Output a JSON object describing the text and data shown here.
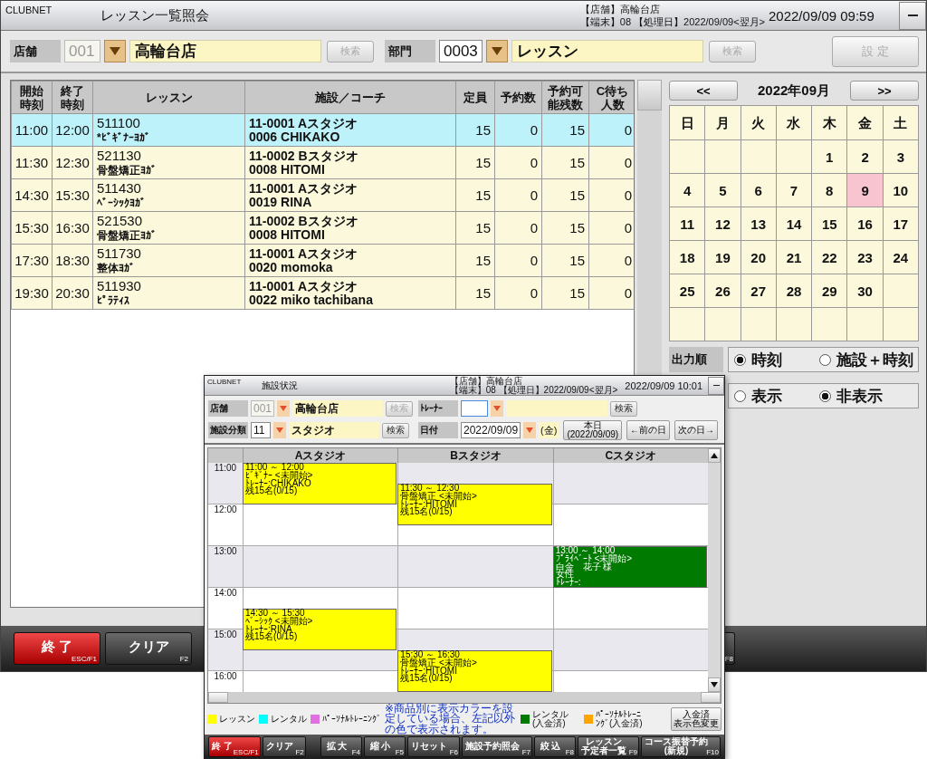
{
  "main": {
    "titlebar": {
      "app": "CLUBNET",
      "title": "レッスン一覧照会",
      "store_info": "【店舗】高輪台店",
      "terminal_info": "【端末】08 【処理日】2022/09/09<翌月>",
      "datetime": "2022/09/09 09:59"
    },
    "filters": [
      {
        "label": "店舗",
        "code": {
          "value": "001",
          "disabled": true
        },
        "name": "高輪台店",
        "search": {
          "label": "検索",
          "disabled": true
        }
      },
      {
        "label": "部門",
        "code": {
          "value": "0003",
          "disabled": false
        },
        "name": "レッスン",
        "search": {
          "label": "検索",
          "disabled": true
        }
      }
    ],
    "settings_button": {
      "label": "設 定",
      "disabled": true
    },
    "table": {
      "columns": [
        "開始時刻",
        "終了時刻",
        "レッスン",
        "施設／コーチ",
        "定員",
        "予約数",
        "予約可能残数",
        "C待ち人数"
      ],
      "rows": [
        {
          "start": "11:00",
          "end": "12:00",
          "lesson_code": "511100",
          "lesson_name": "*ﾋﾞｷﾞﾅｰﾖｶﾞ",
          "facility": "11-0001 Aスタジオ",
          "coach": "0006 CHIKAKO",
          "capacity": "15",
          "reserved": "0",
          "available": "15",
          "waiting": "0",
          "selected": true
        },
        {
          "start": "11:30",
          "end": "12:30",
          "lesson_code": "521130",
          "lesson_name": "骨盤矯正ﾖｶﾞ",
          "facility": "11-0002 Bスタジオ",
          "coach": "0008 HITOMI",
          "capacity": "15",
          "reserved": "0",
          "available": "15",
          "waiting": "0",
          "selected": false
        },
        {
          "start": "14:30",
          "end": "15:30",
          "lesson_code": "511430",
          "lesson_name": "ﾍﾞｰｼｯｸﾖｶﾞ",
          "facility": "11-0001 Aスタジオ",
          "coach": "0019 RINA",
          "capacity": "15",
          "reserved": "0",
          "available": "15",
          "waiting": "0",
          "selected": false
        },
        {
          "start": "15:30",
          "end": "16:30",
          "lesson_code": "521530",
          "lesson_name": "骨盤矯正ﾖｶﾞ",
          "facility": "11-0002 Bスタジオ",
          "coach": "0008 HITOMI",
          "capacity": "15",
          "reserved": "0",
          "available": "15",
          "waiting": "0",
          "selected": false
        },
        {
          "start": "17:30",
          "end": "18:30",
          "lesson_code": "511730",
          "lesson_name": "整体ﾖｶﾞ",
          "facility": "11-0001 Aスタジオ",
          "coach": "0020 momoka",
          "capacity": "15",
          "reserved": "0",
          "available": "15",
          "waiting": "0",
          "selected": false
        },
        {
          "start": "19:30",
          "end": "20:30",
          "lesson_code": "511930",
          "lesson_name": "ﾋﾟﾗﾃｨｽ",
          "facility": "11-0001 Aスタジオ",
          "coach": "0022 miko tachibana",
          "capacity": "15",
          "reserved": "0",
          "available": "15",
          "waiting": "0",
          "selected": false
        }
      ]
    },
    "calendar": {
      "prev": "<<",
      "month": "2022年09月",
      "next": ">>",
      "weekdays": [
        "日",
        "月",
        "火",
        "水",
        "木",
        "金",
        "土"
      ],
      "weeks": [
        [
          {
            "kind": "blank"
          },
          {
            "kind": "blank"
          },
          {
            "kind": "blank"
          },
          {
            "kind": "blank"
          },
          {
            "kind": "day",
            "day": "1",
            "selected": false
          },
          {
            "kind": "day",
            "day": "2",
            "selected": false
          },
          {
            "kind": "day",
            "day": "3",
            "selected": false
          }
        ],
        [
          {
            "kind": "day",
            "day": "4",
            "selected": false
          },
          {
            "kind": "day",
            "day": "5",
            "selected": false
          },
          {
            "kind": "day",
            "day": "6",
            "selected": false
          },
          {
            "kind": "day",
            "day": "7",
            "selected": false
          },
          {
            "kind": "day",
            "day": "8",
            "selected": false
          },
          {
            "kind": "day",
            "day": "9",
            "selected": true
          },
          {
            "kind": "day",
            "day": "10",
            "selected": false
          }
        ],
        [
          {
            "kind": "day",
            "day": "11",
            "selected": false
          },
          {
            "kind": "day",
            "day": "12",
            "selected": false
          },
          {
            "kind": "day",
            "day": "13",
            "selected": false
          },
          {
            "kind": "day",
            "day": "14",
            "selected": false
          },
          {
            "kind": "day",
            "day": "15",
            "selected": false
          },
          {
            "kind": "day",
            "day": "16",
            "selected": false
          },
          {
            "kind": "day",
            "day": "17",
            "selected": false
          }
        ],
        [
          {
            "kind": "day",
            "day": "18",
            "selected": false
          },
          {
            "kind": "day",
            "day": "19",
            "selected": false
          },
          {
            "kind": "day",
            "day": "20",
            "selected": false
          },
          {
            "kind": "day",
            "day": "21",
            "selected": false
          },
          {
            "kind": "day",
            "day": "22",
            "selected": false
          },
          {
            "kind": "day",
            "day": "23",
            "selected": false
          },
          {
            "kind": "day",
            "day": "24",
            "selected": false
          }
        ],
        [
          {
            "kind": "day",
            "day": "25",
            "selected": false
          },
          {
            "kind": "day",
            "day": "26",
            "selected": false
          },
          {
            "kind": "day",
            "day": "27",
            "selected": false
          },
          {
            "kind": "day",
            "day": "28",
            "selected": false
          },
          {
            "kind": "day",
            "day": "29",
            "selected": false
          },
          {
            "kind": "day",
            "day": "30",
            "selected": false
          },
          {
            "kind": "blank"
          }
        ],
        [
          {
            "kind": "blank"
          },
          {
            "kind": "blank"
          },
          {
            "kind": "blank"
          },
          {
            "kind": "blank"
          },
          {
            "kind": "blank"
          },
          {
            "kind": "blank"
          },
          {
            "kind": "blank"
          }
        ]
      ]
    },
    "output_order": {
      "label": "出力順",
      "options": [
        {
          "label": "時刻",
          "selected": true
        },
        {
          "label": "施設＋時刻",
          "selected": false
        }
      ]
    },
    "display": {
      "options": [
        {
          "label": "表示",
          "selected": false
        },
        {
          "label": "非表示",
          "selected": true
        }
      ]
    },
    "footer": [
      {
        "kind": "exit",
        "label": "終 了",
        "key": "ESC/F1"
      },
      {
        "kind": "normal",
        "label": "クリア",
        "key": "F2"
      },
      {
        "kind": "hidden",
        "key": "F8"
      }
    ]
  },
  "facility": {
    "titlebar": {
      "app": "CLUBNET",
      "title": "施設状況",
      "store_info": "【店舗】高輪台店",
      "terminal_info": "【端末】08 【処理日】2022/09/09<翌月>",
      "datetime": "2022/09/09 10:01"
    },
    "filters": [
      [
        {
          "kind": "lookup",
          "label": "店舗",
          "code": {
            "value": "001",
            "disabled": true
          },
          "name": "高輪台店",
          "search": {
            "label": "検索",
            "disabled": true
          }
        },
        {
          "kind": "lookup",
          "label": "ﾄﾚｰﾅｰ",
          "code": {
            "disabled": false,
            "focused": true
          },
          "search": {
            "label": "検索",
            "disabled": false
          }
        }
      ],
      [
        {
          "kind": "lookup",
          "label": "施設分類",
          "code": {
            "value": "11",
            "disabled": false
          },
          "name": "スタジオ",
          "search": {
            "label": "検索",
            "disabled": false
          }
        },
        {
          "kind": "date",
          "label": "日付",
          "date": "2022/09/09",
          "weekday": "(金)",
          "buttons": [
            {
              "lines": [
                "本日",
                "(2022/09/09)"
              ]
            },
            {
              "lines": [
                "←前の日"
              ]
            },
            {
              "lines": [
                "次の日→"
              ]
            }
          ]
        }
      ]
    ],
    "schedule": {
      "times": [
        "11:00",
        "12:00",
        "13:00",
        "14:00",
        "15:00",
        "16:00"
      ],
      "columns": [
        {
          "name": "Aスタジオ",
          "slots": [
            {
              "kind": "event",
              "color": "#ffff00",
              "lines": [
                "11:00 ～ 12:00",
                "ﾋﾞｷﾞﾅｰ <未開始>",
                "ﾄﾚｰﾅｰ:CHIKAKO",
                "残15名(0/15)"
              ]
            },
            {
              "kind": "free"
            },
            {
              "kind": "free"
            },
            {
              "kind": "free"
            },
            {
              "kind": "free"
            },
            {
              "kind": "free"
            },
            {
              "kind": "event",
              "color": "#ffff00",
              "lines": [
                "14:30 ～ 15:30",
                "ﾍﾞｰｼｯｸ <未開始>",
                "ﾄﾚｰﾅｰ:RINA",
                "残15名(0/15)"
              ]
            },
            {
              "kind": "free"
            },
            {
              "kind": "free"
            },
            {
              "kind": "free"
            }
          ]
        },
        {
          "name": "Bスタジオ",
          "slots": [
            {
              "kind": "free"
            },
            {
              "kind": "event",
              "color": "#ffff00",
              "lines": [
                "11:30 ～ 12:30",
                "骨盤矯正 <未開始>",
                "ﾄﾚｰﾅｰ:HITOMI",
                "残15名(0/15)"
              ]
            },
            {
              "kind": "free"
            },
            {
              "kind": "free"
            },
            {
              "kind": "free"
            },
            {
              "kind": "free"
            },
            {
              "kind": "free"
            },
            {
              "kind": "free"
            },
            {
              "kind": "event",
              "color": "#ffff00",
              "lines": [
                "15:30 ～ 16:30",
                "骨盤矯正 <未開始>",
                "ﾄﾚｰﾅｰ:HITOMI",
                "残15名(0/15)"
              ]
            }
          ]
        },
        {
          "name": "Cスタジオ",
          "slots": [
            {
              "kind": "free"
            },
            {
              "kind": "free"
            },
            {
              "kind": "free"
            },
            {
              "kind": "free"
            },
            {
              "kind": "event",
              "color": "#007a00",
              "lines": [
                "13:00 ～ 14:00",
                "ﾌﾟﾗｲﾍﾞｰﾄ <未開始>",
                "白金　花子 様",
                "女性",
                "ﾄﾚｰﾅｰ:"
              ]
            },
            {
              "kind": "free"
            },
            {
              "kind": "free"
            },
            {
              "kind": "free"
            },
            {
              "kind": "free"
            },
            {
              "kind": "free"
            }
          ]
        }
      ]
    },
    "legend": [
      {
        "kind": "swatch",
        "label": "レッスン",
        "color": "#ffff00"
      },
      {
        "kind": "swatch",
        "label": "レンタル",
        "color": "#00ffff"
      },
      {
        "kind": "swatch",
        "label": "ﾊﾟｰｿﾅﾙﾄﾚｰﾆﾝｸﾞ",
        "color": "#e070e0"
      },
      {
        "kind": "note",
        "text": "※商品別に表示カラーを設定している場合、左記以外の色で表示されます。"
      },
      {
        "kind": "swatch",
        "label": "レンタル(入金済)",
        "color": "#007a00"
      },
      {
        "kind": "swatch",
        "label": "ﾊﾟｰｿﾅﾙﾄﾚｰﾆﾝｸﾞ(入金済)",
        "color": "#ffa500"
      },
      {
        "kind": "button",
        "lines": [
          "入金済",
          "表示色変更"
        ]
      }
    ],
    "toolbar": [
      {
        "kind": "exit",
        "lines": [
          "終 了"
        ],
        "key": "ESC/F1"
      },
      {
        "kind": "normal",
        "lines": [
          "クリア"
        ],
        "key": "F2"
      },
      {
        "kind": "spacer"
      },
      {
        "kind": "normal",
        "lines": [
          "拡 大"
        ],
        "key": "F4"
      },
      {
        "kind": "normal",
        "lines": [
          "縮 小"
        ],
        "key": "F5"
      },
      {
        "kind": "normal",
        "lines": [
          "リセット"
        ],
        "key": "F6"
      },
      {
        "kind": "normal",
        "lines": [
          "施設予約照会"
        ],
        "key": "F7"
      },
      {
        "kind": "normal",
        "lines": [
          "絞 込"
        ],
        "key": "F8"
      },
      {
        "kind": "normal",
        "lines": [
          "レッスン",
          "予定者一覧"
        ],
        "key": "F9"
      },
      {
        "kind": "normal",
        "lines": [
          "コース振替予約",
          "(新規)"
        ],
        "key": "F10"
      }
    ]
  }
}
